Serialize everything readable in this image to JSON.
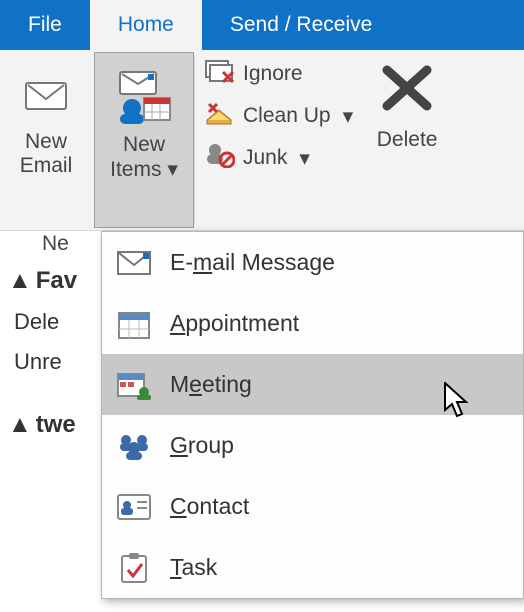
{
  "tabs": {
    "file": "File",
    "home": "Home",
    "send_receive": "Send / Receive"
  },
  "ribbon": {
    "new_email_l1": "New",
    "new_email_l2": "Email",
    "new_items_l1": "New",
    "new_items_l2": "Items",
    "ignore": "Ignore",
    "cleanup": "Clean Up",
    "junk": "Junk",
    "delete": "Delete",
    "truncated_ne": "Ne"
  },
  "nav": {
    "favorites": "Fav",
    "deleted": "Dele",
    "unread": "Unre",
    "twe": "twe"
  },
  "dropdown": {
    "email_pre": "E-",
    "email_u": "m",
    "email_post": "ail Message",
    "appt_u": "A",
    "appt_post": "ppointment",
    "meeting_pre": "M",
    "meeting_u": "e",
    "meeting_post": "eting",
    "group_u": "G",
    "group_post": "roup",
    "contact_u": "C",
    "contact_post": "ontact",
    "task_u": "T",
    "task_post": "ask"
  },
  "icons": {
    "dropdown_triangle": "▾"
  }
}
